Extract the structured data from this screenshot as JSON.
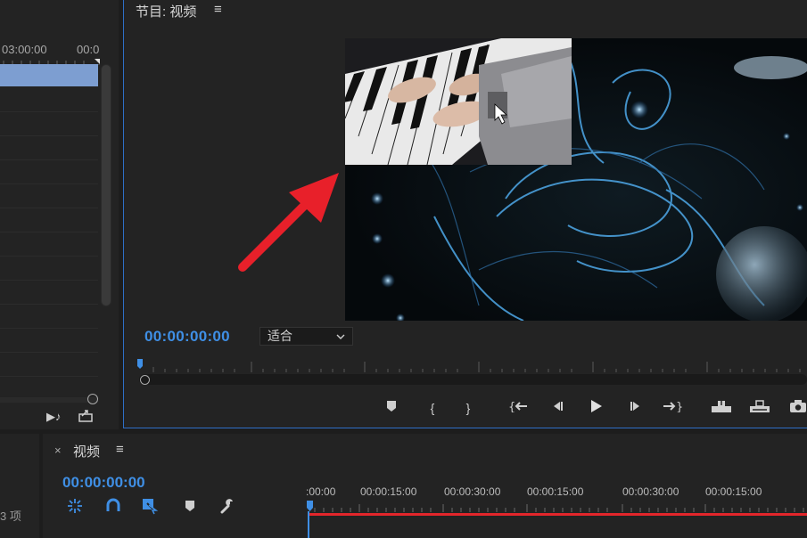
{
  "source_panel": {
    "timecodes": [
      "03:00:00",
      "00:0"
    ]
  },
  "program_monitor": {
    "title": "节目: 视频",
    "timecode": "00:00:00:00",
    "zoom": "适合"
  },
  "project_panel": {
    "item_count": "3 项"
  },
  "timeline": {
    "title": "视频",
    "timecode": "00:00:00:00",
    "ruler_labels": [
      ":00:00",
      "00:00:15:00",
      "00:00:30:00",
      "00:00:15:00",
      "00:00:30:00",
      "00:00:15:00"
    ]
  },
  "colors": {
    "accent": "#3f8fe5",
    "playhead_range": "#e3262b",
    "annotation_arrow": "#e8202a"
  }
}
